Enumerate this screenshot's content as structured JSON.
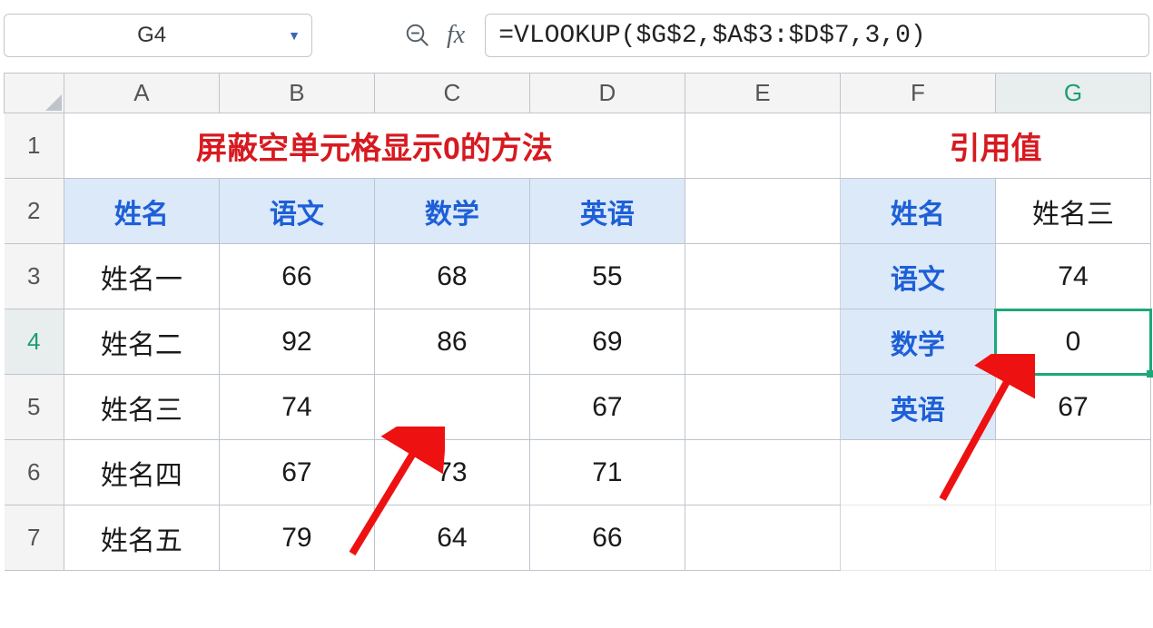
{
  "namebox": {
    "value": "G4"
  },
  "formula": {
    "value": "=VLOOKUP($G$2,$A$3:$D$7,3,0)"
  },
  "columns": [
    "A",
    "B",
    "C",
    "D",
    "E",
    "F",
    "G"
  ],
  "row_headers": [
    "1",
    "2",
    "3",
    "4",
    "5",
    "6",
    "7"
  ],
  "active": {
    "row": "4",
    "col": "G"
  },
  "left": {
    "title": "屏蔽空单元格显示0的方法",
    "headers": [
      "姓名",
      "语文",
      "数学",
      "英语"
    ],
    "rows": [
      [
        "姓名一",
        "66",
        "68",
        "55"
      ],
      [
        "姓名二",
        "92",
        "86",
        "69"
      ],
      [
        "姓名三",
        "74",
        "",
        "67"
      ],
      [
        "姓名四",
        "67",
        "73",
        "71"
      ],
      [
        "姓名五",
        "79",
        "64",
        "66"
      ]
    ]
  },
  "right": {
    "title": "引用值",
    "pairs": [
      {
        "label": "姓名",
        "value": "姓名三"
      },
      {
        "label": "语文",
        "value": "74"
      },
      {
        "label": "数学",
        "value": "0"
      },
      {
        "label": "英语",
        "value": "67"
      }
    ]
  },
  "chart_data": {
    "type": "table",
    "left_table": {
      "title": "屏蔽空单元格显示0的方法",
      "columns": [
        "姓名",
        "语文",
        "数学",
        "英语"
      ],
      "rows": [
        [
          "姓名一",
          66,
          68,
          55
        ],
        [
          "姓名二",
          92,
          86,
          69
        ],
        [
          "姓名三",
          74,
          null,
          67
        ],
        [
          "姓名四",
          67,
          73,
          71
        ],
        [
          "姓名五",
          79,
          64,
          66
        ]
      ]
    },
    "right_table": {
      "title": "引用值",
      "lookup_name": "姓名三",
      "语文": 74,
      "数学": 0,
      "英语": 67
    }
  }
}
